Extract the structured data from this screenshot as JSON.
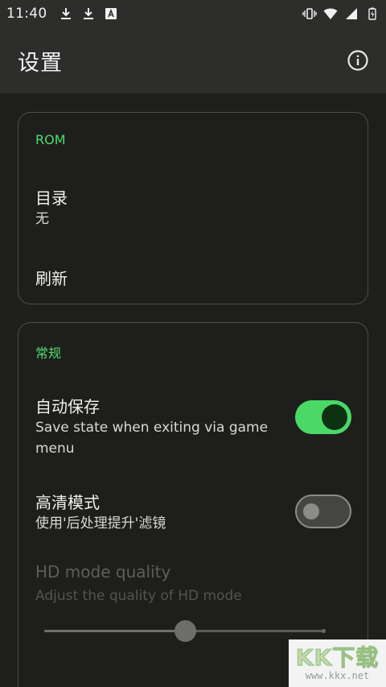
{
  "status_bar": {
    "time": "11:40",
    "left_icons": [
      "download-icon",
      "download-icon",
      "text-a-icon"
    ],
    "right_icons": [
      "vibrate-icon",
      "wifi-icon",
      "signal-icon",
      "battery-icon"
    ]
  },
  "app_bar": {
    "title": "设置",
    "info_icon": "info-icon"
  },
  "sections": {
    "rom": {
      "header": "ROM",
      "directory": {
        "title": "目录",
        "subtitle": "无"
      },
      "refresh": {
        "title": "刷新"
      }
    },
    "general": {
      "header": "常规",
      "auto_save": {
        "title": "自动保存",
        "subtitle_line1": "Save state when exiting via game",
        "subtitle_line2": "menu",
        "enabled": true
      },
      "hd_mode": {
        "title": "高清模式",
        "subtitle": "使用'后处理提升'滤镜",
        "enabled": false
      },
      "hd_quality": {
        "title": "HD mode quality",
        "subtitle": "Adjust the quality of HD mode",
        "value_fraction": 0.5,
        "disabled": true
      }
    }
  },
  "watermark": {
    "logo": "KK下载",
    "url": "www.kkx.net"
  },
  "colors": {
    "accent": "#4fdb6e",
    "background": "#1e1f1d",
    "app_bar": "#2d2e2c"
  }
}
